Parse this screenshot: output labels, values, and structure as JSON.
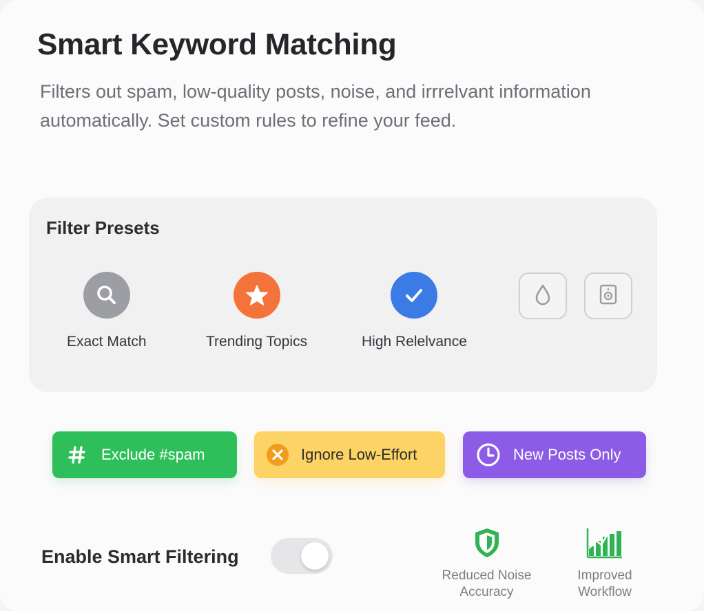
{
  "header": {
    "title": "Smart Keyword Matching",
    "description": "Filters out spam, low-quality posts, noise, and irrrelvant information automatically. Set custom rules to refine your feed."
  },
  "presets": {
    "title": "Filter Presets",
    "items": [
      {
        "label": "Exact Match",
        "icon": "search-icon",
        "color": "#9c9ea3"
      },
      {
        "label": "Trending Topics",
        "icon": "star-icon",
        "color": "#f4733a"
      },
      {
        "label": "High Relelvance",
        "icon": "check-icon",
        "color": "#3b7be6"
      }
    ],
    "extra_buttons": [
      {
        "icon": "drop-icon"
      },
      {
        "icon": "speaker-icon"
      }
    ]
  },
  "chips": [
    {
      "label": "Exclude #spam",
      "icon": "hash-icon",
      "color": "#2fbf5a"
    },
    {
      "label": "Ignore Low-Effort",
      "icon": "close-circle-icon",
      "color": "#fdd365"
    },
    {
      "label": "New Posts Only",
      "icon": "clock-icon",
      "color": "#8c5ce6"
    }
  ],
  "smart_filtering": {
    "label": "Enable Smart Filtering",
    "enabled": false
  },
  "features": [
    {
      "line1": "Reduced Noise",
      "line2": "Accuracy",
      "icon": "shield-icon",
      "color": "#2fb455"
    },
    {
      "line1": "Improved",
      "line2": "Workflow",
      "icon": "bar-chart-icon",
      "color": "#2fb455"
    }
  ]
}
